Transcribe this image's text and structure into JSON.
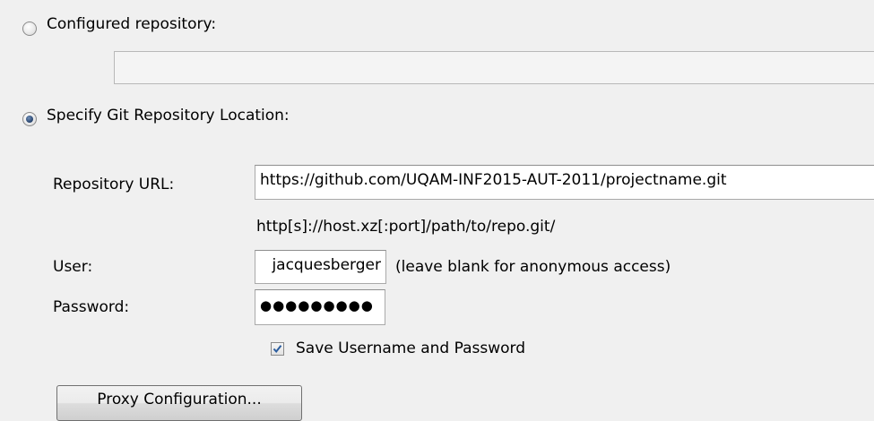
{
  "configured": {
    "radio_label": "Configured repository:",
    "field_value": ""
  },
  "specify": {
    "radio_label": "Specify Git Repository Location:"
  },
  "form": {
    "url_label": "Repository URL:",
    "url_value": "https://github.com/UQAM-INF2015-AUT-2011/projectname.git",
    "url_hint": "http[s]://host.xz[:port]/path/to/repo.git/",
    "user_label": "User:",
    "user_value": "jacquesberger",
    "user_hint": "(leave blank for anonymous access)",
    "password_label": "Password:",
    "password_value": "●●●●●●●●●",
    "save_label": "Save Username and Password"
  },
  "proxy_button_label": "Proxy Configuration..."
}
